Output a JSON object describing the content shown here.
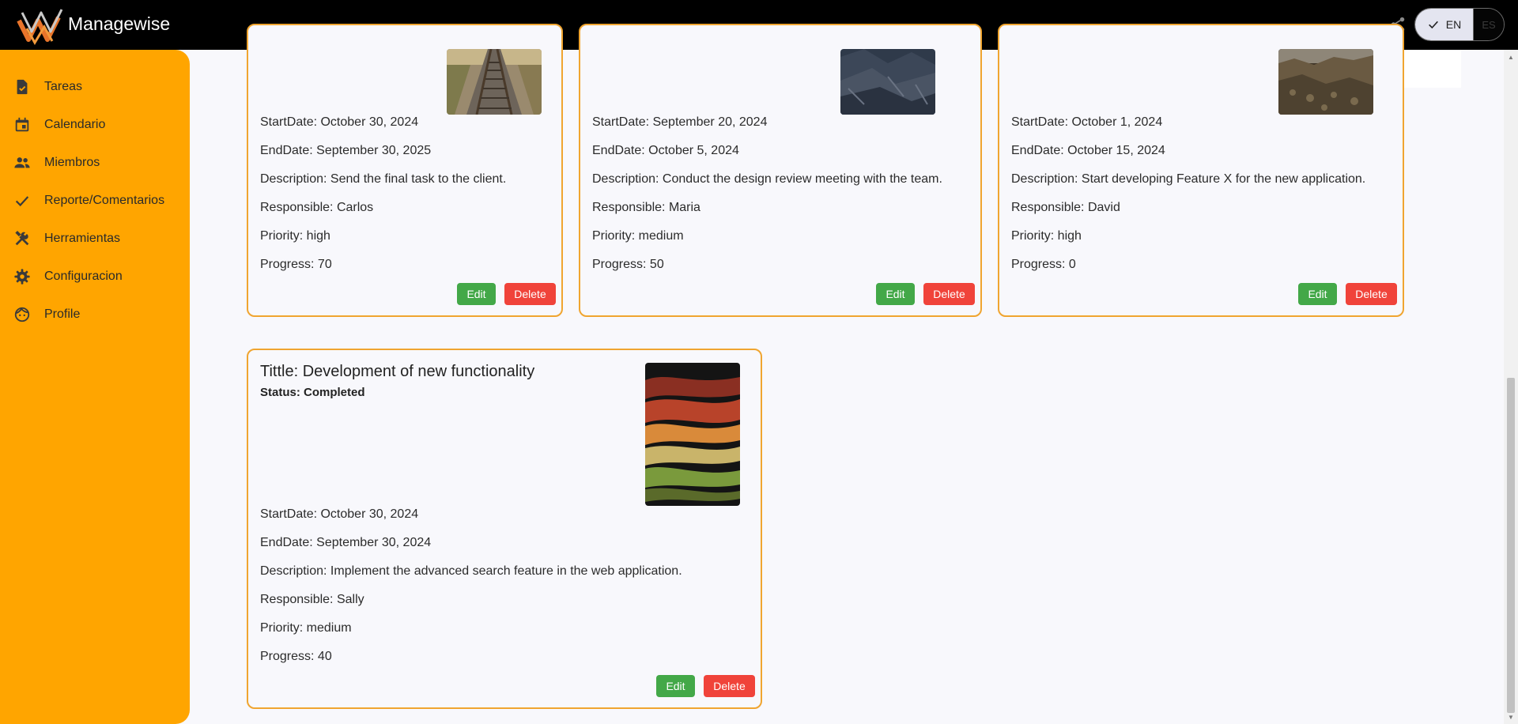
{
  "app": {
    "brand": "Managewise"
  },
  "lang": {
    "en": "EN",
    "es": "ES"
  },
  "sidebar": {
    "items": [
      {
        "label": "Tareas",
        "icon": "task-icon"
      },
      {
        "label": "Calendario",
        "icon": "calendar-icon"
      },
      {
        "label": "Miembros",
        "icon": "people-icon"
      },
      {
        "label": "Reporte/Comentarios",
        "icon": "check-icon"
      },
      {
        "label": "Herramientas",
        "icon": "tools-icon"
      },
      {
        "label": "Configuracion",
        "icon": "gear-icon"
      },
      {
        "label": "Profile",
        "icon": "face-icon"
      }
    ]
  },
  "labels": {
    "edit": "Edit",
    "delete": "Delete"
  },
  "cards": [
    {
      "start": "StartDate: October 30, 2024",
      "end": "EndDate: September 30, 2025",
      "description": "Description: Send the final task to the client.",
      "responsible": "Responsible: Carlos",
      "priority": "Priority: high",
      "progress": "Progress: 70"
    },
    {
      "start": "StartDate: September 20, 2024",
      "end": "EndDate: October 5, 2024",
      "description": "Description: Conduct the design review meeting with the team.",
      "responsible": "Responsible: Maria",
      "priority": "Priority: medium",
      "progress": "Progress: 50"
    },
    {
      "start": "StartDate: October 1, 2024",
      "end": "EndDate: October 15, 2024",
      "description": "Description: Start developing Feature X for the new application.",
      "responsible": "Responsible: David",
      "priority": "Priority: high",
      "progress": "Progress: 0"
    },
    {
      "title": "Tittle: Development of new functionality",
      "status": "Status: Completed",
      "start": "StartDate: October 30, 2024",
      "end": "EndDate: September 30, 2024",
      "description": "Description: Implement the advanced search feature in the web application.",
      "responsible": "Responsible: Sally",
      "priority": "Priority: medium",
      "progress": "Progress: 40"
    }
  ],
  "colors": {
    "accent": "#ffa500",
    "card_border": "#f0a530",
    "edit": "#43a848",
    "delete": "#f0433a"
  }
}
